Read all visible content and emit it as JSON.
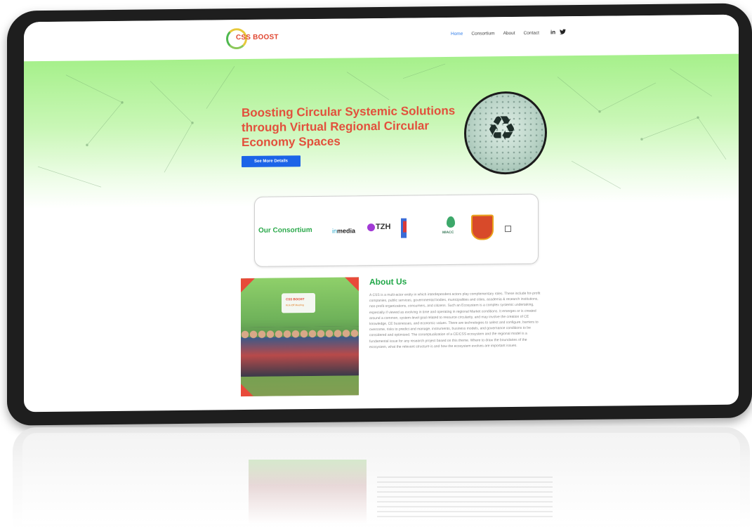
{
  "header": {
    "logo_text": "CSS BOOST",
    "nav": [
      {
        "label": "Home",
        "active": true
      },
      {
        "label": "Consortium",
        "active": false
      },
      {
        "label": "About",
        "active": false
      },
      {
        "label": "Contact",
        "active": false
      }
    ],
    "social": {
      "linkedin": "in",
      "twitter": "🐦"
    }
  },
  "hero": {
    "title": "Boosting Circular Systemic Solutions through Virtual Regional Circular Economy Spaces",
    "button_label": "See More Details",
    "image_icon": "recycle-icon"
  },
  "consortium": {
    "title": "Our Consortium",
    "partners": [
      {
        "name": "inmedia",
        "prefix": "in",
        "suffix": "media"
      },
      {
        "name": "TZH",
        "label": "TZH"
      },
      {
        "name": "partner-3"
      },
      {
        "name": "MACC",
        "label": "MIACC"
      },
      {
        "name": "partner-5"
      },
      {
        "name": "partner-6"
      }
    ]
  },
  "about": {
    "title": "About Us",
    "image_banner_title": "CSS BOOST",
    "image_banner_subtitle": "Kick-Off Meeting",
    "text": "A CSS is a multi-actor entity in which interdependent actors play complementary roles. These include for-profit companies, public services, governmental bodies, municipalities and cities, academia & research institutions, non-profit organizations, consumers, and citizens. Such an Ecosystem is a complex systemic undertaking, especially if viewed as evolving in time and operating in regional Market conditions. It emerges or is created around a common, system-level goal related to resource circularity, and may involve the creation of CE knowledge, CE businesses, and economic values. There are technologies to select and configure, barriers to overcome, risks to predict and manage, instruments, business models, and governance conditions to be considered and optimized. The conceptualization of a CE/CSS ecosystem and the regional model is a fundamental issue for any research project based on this theme. Where to draw the boundaries of the ecosystem, what the relevant structure is and how the ecosystem evolves are important issues."
  },
  "colors": {
    "accent_red": "#e2503c",
    "accent_green": "#23a84a",
    "button_blue": "#1c64e8",
    "hero_green": "#a6f08b"
  }
}
